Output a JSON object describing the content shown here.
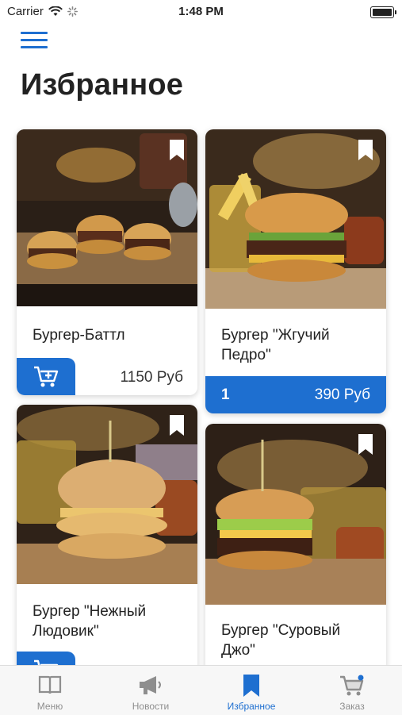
{
  "status_bar": {
    "carrier": "Carrier",
    "time": "1:48 PM"
  },
  "header": {
    "title": "Избранное"
  },
  "products": [
    {
      "name": "Бургер-Баттл",
      "price": "1150 Руб",
      "in_cart": false,
      "bookmarked": true
    },
    {
      "name": "Бургер \"Жгучий Педро\"",
      "price": "390 Руб",
      "quantity": "1",
      "in_cart": true,
      "bookmarked": true
    },
    {
      "name": "Бургер \"Нежный Людовик\"",
      "in_cart": false,
      "bookmarked": true
    },
    {
      "name": "Бургер \"Суровый Джо\"",
      "bookmarked": true
    }
  ],
  "tabbar": {
    "active": "favorites",
    "items": [
      {
        "id": "menu",
        "label": "Меню",
        "icon": "book-icon"
      },
      {
        "id": "news",
        "label": "Новости",
        "icon": "megaphone-icon"
      },
      {
        "id": "favorites",
        "label": "Избранное",
        "icon": "bookmark-icon"
      },
      {
        "id": "order",
        "label": "Заказ",
        "icon": "cart-icon"
      }
    ]
  },
  "colors": {
    "accent": "#1e6fd0",
    "tab_inactive": "#8e8e8e"
  }
}
